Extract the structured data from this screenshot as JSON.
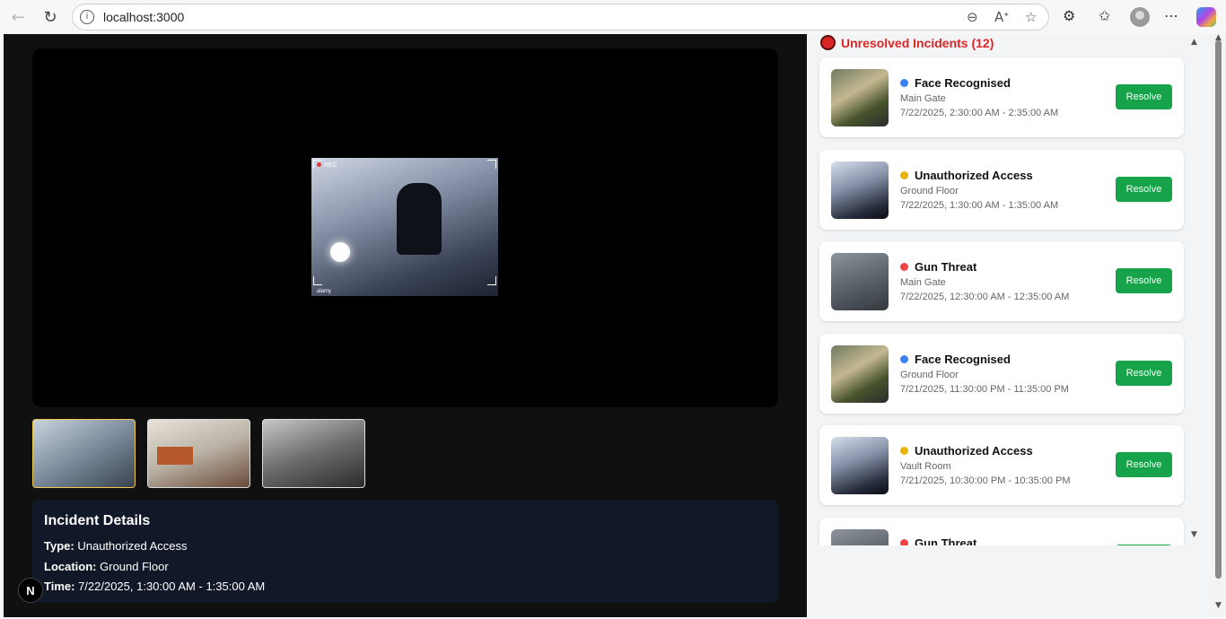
{
  "browser": {
    "url": "localhost:3000",
    "back_icon": "←",
    "reload_icon": "↻",
    "info_icon": "i",
    "zoom_icon": "⊖",
    "read_aloud_icon": "Aᐩ",
    "favorite_icon": "☆",
    "extensions_icon": "⚙",
    "favorites_bar_icon": "✩",
    "more_icon": "⋯"
  },
  "video": {
    "rec_label": "REC",
    "watermark": "alamy"
  },
  "details": {
    "title": "Incident Details",
    "type_label": "Type:",
    "type_value": "Unauthorized Access",
    "location_label": "Location:",
    "location_value": "Ground Floor",
    "time_label": "Time:",
    "time_value": "7/22/2025, 1:30:00 AM - 1:35:00 AM"
  },
  "nextjs_badge": "N",
  "incidents": {
    "header": "Unresolved Incidents (12)",
    "resolve_label": "Resolve",
    "items": [
      {
        "type": "Face Recognised",
        "location": "Main Gate",
        "time": "7/22/2025, 2:30:00 AM - 2:35:00 AM",
        "color": "#3b82f6",
        "kind": "face"
      },
      {
        "type": "Unauthorized Access",
        "location": "Ground Floor",
        "time": "7/22/2025, 1:30:00 AM - 1:35:00 AM",
        "color": "#eab308",
        "kind": "unauth"
      },
      {
        "type": "Gun Threat",
        "location": "Main Gate",
        "time": "7/22/2025, 12:30:00 AM - 12:35:00 AM",
        "color": "#ef4444",
        "kind": "gun"
      },
      {
        "type": "Face Recognised",
        "location": "Ground Floor",
        "time": "7/21/2025, 11:30:00 PM - 11:35:00 PM",
        "color": "#3b82f6",
        "kind": "face"
      },
      {
        "type": "Unauthorized Access",
        "location": "Vault Room",
        "time": "7/21/2025, 10:30:00 PM - 10:35:00 PM",
        "color": "#eab308",
        "kind": "unauth"
      },
      {
        "type": "Gun Threat",
        "location": "",
        "time": "",
        "color": "#ef4444",
        "kind": "gun"
      }
    ]
  },
  "colors": {
    "accent_red": "#dc2626",
    "resolve_green": "#16a34a",
    "active_thumb": "#f2c94c"
  }
}
